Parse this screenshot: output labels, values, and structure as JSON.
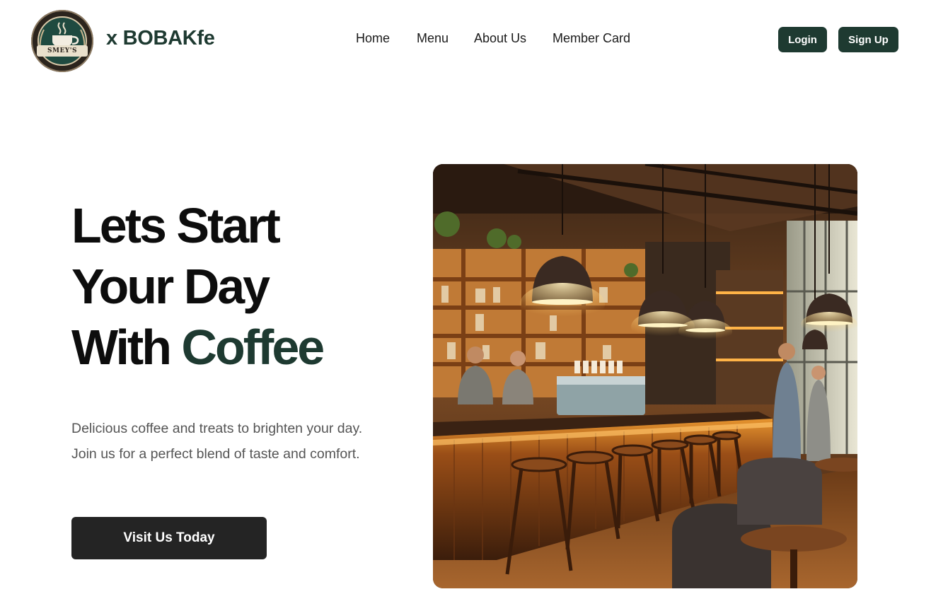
{
  "header": {
    "logo_text": "SMEY'S",
    "logo_subtext": "COFFEE",
    "brand": "x BOBAKfe",
    "nav": [
      "Home",
      "Menu",
      "About Us",
      "Member Card"
    ],
    "login_label": "Login",
    "signup_label": "Sign Up"
  },
  "hero": {
    "title_line1": "Lets Start",
    "title_line2": "Your Day",
    "title_line3_prefix": "With ",
    "title_line3_accent": "Coffee",
    "description": "Delicious coffee and treats to brighten your day. Join us for a perfect blend of taste and comfort.",
    "cta_label": "Visit Us Today"
  },
  "colors": {
    "brand_green": "#1e3a31",
    "cta_dark": "#242424",
    "text_muted": "#555555"
  },
  "icons": {
    "logo": "coffee-cup-badge-icon"
  }
}
